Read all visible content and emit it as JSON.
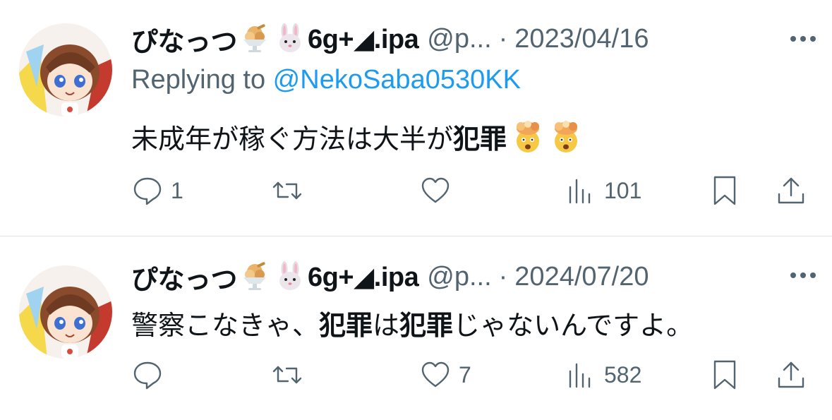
{
  "tweets": [
    {
      "display_name": "ぴなっつ",
      "name_suffix": "6g+◢.ipa",
      "name_emojis": [
        "ice-cream-emoji",
        "rabbit-face-emoji"
      ],
      "handle": "@p...",
      "separator": "·",
      "date": "2023/04/16",
      "replying_prefix": "Replying to ",
      "replying_to": "@NekoSaba0530KK",
      "text_parts": [
        {
          "text": "未成年が稼ぐ方法は大半が",
          "bold": false
        },
        {
          "text": "犯罪",
          "bold": true
        }
      ],
      "text_emojis": [
        "exploding-head-emoji",
        "exploding-head-emoji"
      ],
      "reply_count": "1",
      "like_count": "",
      "views_count": "101"
    },
    {
      "display_name": "ぴなっつ",
      "name_suffix": "6g+◢.ipa",
      "name_emojis": [
        "ice-cream-emoji",
        "rabbit-face-emoji"
      ],
      "handle": "@p...",
      "separator": "·",
      "date": "2024/07/20",
      "text_parts": [
        {
          "text": "警察こなきゃ、",
          "bold": false
        },
        {
          "text": "犯罪",
          "bold": true
        },
        {
          "text": "は",
          "bold": false
        },
        {
          "text": "犯罪",
          "bold": true
        },
        {
          "text": "じゃないんですよ。",
          "bold": false
        }
      ],
      "reply_count": "",
      "like_count": "7",
      "views_count": "582"
    }
  ],
  "icons": {
    "reply": "speech-bubble-icon",
    "retweet": "retweet-icon",
    "like": "heart-icon",
    "views": "bar-chart-icon",
    "bookmark": "bookmark-icon",
    "share": "share-upload-icon",
    "more": "more-dots-icon"
  },
  "colors": {
    "text": "#0f1419",
    "secondary": "#536471",
    "link": "#1d9bf0",
    "divider": "#dfe3e6"
  }
}
